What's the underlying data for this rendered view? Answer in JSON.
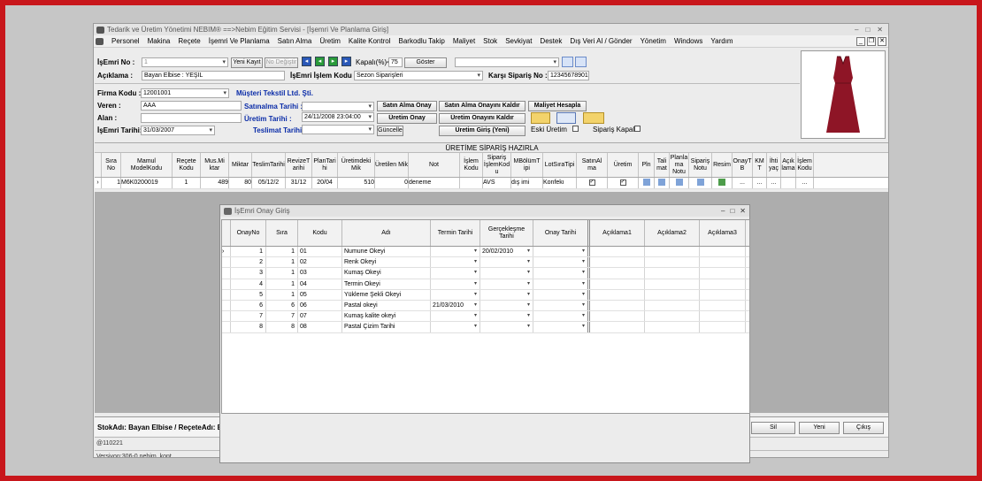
{
  "window": {
    "title": "Tedarik ve Üretim Yönetimi   NEBIM® ==>Nebim Eğitim Servisi - [İşemri Ve Planlama Giriş]"
  },
  "menu": [
    "Personel",
    "Makina",
    "Reçete",
    "İşemri Ve Planlama",
    "Satın Alma",
    "Üretim",
    "Kalite Kontrol",
    "Barkodlu Takip",
    "Maliyet",
    "Stok",
    "Sevkiyat",
    "Destek",
    "Dış Veri Al / Gönder",
    "Yönetim",
    "Windows",
    "Yardım"
  ],
  "header": {
    "isemri_label": "İşEmri No :",
    "isemri_value": "1",
    "yeni_kayit": "Yeni Kayıt",
    "no_degistir": "No Değiştir",
    "kapali_label": "Kapalı(%)<",
    "kapali_value": "75",
    "goster": "Göster",
    "aciklama_label": "Açıklama :",
    "aciklama_value": "Bayan Elbise : YEŞİL",
    "islem_kodu_label": "İşEmri İşlem Kodu :",
    "islem_kodu_value": "Sezon Siparişleri",
    "karsi_siparis_label": "Karşı Sipariş No :",
    "karsi_siparis_value": "12345678901"
  },
  "form": {
    "firma_label": "Firma Kodu :",
    "firma_value": "12001001",
    "firma_name": "Müşteri Tekstil Ltd. Şti.",
    "veren_label": "Veren :",
    "veren_value": "AAA",
    "alan_label": "Alan :",
    "alan_value": "",
    "isemri_tarihi_label": "İşEmri Tarihi:",
    "isemri_tarihi_value": "31/03/2007",
    "satinalma_tarihi_label": "Satınalma Tarihi :",
    "satinalma_tarihi_value": "",
    "uretim_tarihi_label": "Üretim Tarihi :",
    "uretim_tarihi_value": "24/11/2008 23:04:00",
    "teslimat_tarihi_label": "Teslimat Tarihi :",
    "teslimat_tarihi_value": "",
    "btn_satin_alma_onay": "Satın Alma Onay",
    "btn_satin_alma_kaldir": "Satın Alma Onayını Kaldır",
    "btn_maliyet": "Maliyet Hesapla",
    "btn_uretim_onay": "Üretim Onay",
    "btn_uretim_onay_kaldir": "Üretim Onayını Kaldır",
    "btn_guncelle": "Güncelle",
    "btn_uretim_giris": "Üretim Giriş (Yeni)",
    "eski_uretim": "Eski Üretim",
    "siparis_kapali": "Sipariş Kapalı"
  },
  "grid": {
    "caption": "ÜRETİME SİPARİŞ HAZIRLA",
    "headers": [
      "Sıra No",
      "Mamul ModelKodu",
      "Reçete Kodu",
      "Mus.Mi ktar",
      "Miktar",
      "TeslimTarihi",
      "RevizeT arihi",
      "PlanTari hi",
      "Üretimdeki Mik",
      "Üretilen Mik",
      "Not",
      "İşlem Kodu",
      "Sipariş İşlemKod u",
      "MBölümT ipi",
      "LotSıraTipi",
      "SatınAl ma",
      "Üretim",
      "Pln",
      "Tali mat",
      "Planla ma Notu",
      "Sipariş Notu",
      "Resim",
      "OnayT B",
      "KM T",
      "İhti yaç",
      "Açık lama",
      "İşlem Kodu"
    ],
    "row": [
      "1",
      "M6K0200019",
      "1",
      "489",
      "80",
      "05/12/2",
      "31/12",
      "20/04",
      "510",
      "0",
      "deneme",
      "",
      "AVS",
      "dış imi",
      "Konfekı",
      "",
      "",
      "",
      "",
      "",
      "",
      "",
      "...",
      "...",
      "...",
      "",
      "..."
    ]
  },
  "footer": {
    "stok": "StokAdı: Bayan Elbise / ReçeteAdı: Bayan",
    "status1": "@110221",
    "status2": "Versiyon:306-0     nebim_kont",
    "btn_sil": "Sil",
    "btn_yeni": "Yeni",
    "btn_cikis": "Çıkış"
  },
  "dialog": {
    "title": "İşEmri Onay Giriş",
    "headers": [
      "OnayNo",
      "Sıra",
      "Kodu",
      "Adı",
      "Termin Tarihi",
      "Gerçekleşme Tarihi",
      "Onay Tarihi",
      "Açıklama1",
      "Açıklama2",
      "Açıklama3"
    ],
    "rows": [
      [
        "1",
        "1",
        "01",
        "Numune Okeyi",
        "",
        "20/02/2010",
        ""
      ],
      [
        "2",
        "1",
        "02",
        "Renk Okeyi",
        "",
        "",
        ""
      ],
      [
        "3",
        "1",
        "03",
        "Kumaş Okeyi",
        "",
        "",
        ""
      ],
      [
        "4",
        "1",
        "04",
        "Termin Okeyi",
        "",
        "",
        ""
      ],
      [
        "5",
        "1",
        "05",
        "Yükleme Şekli Okeyi",
        "",
        "",
        ""
      ],
      [
        "6",
        "6",
        "06",
        "Pastal okeyi",
        "21/03/2010",
        "",
        ""
      ],
      [
        "7",
        "7",
        "07",
        "Kumaş kalite okeyi",
        "",
        "",
        ""
      ],
      [
        "8",
        "8",
        "08",
        "Pastal Çizim Tarihi",
        "",
        "",
        ""
      ]
    ]
  },
  "colors": {
    "frame": "#c8161b",
    "accent_blue": "#0a2ca8",
    "dress": "#8e1526"
  }
}
